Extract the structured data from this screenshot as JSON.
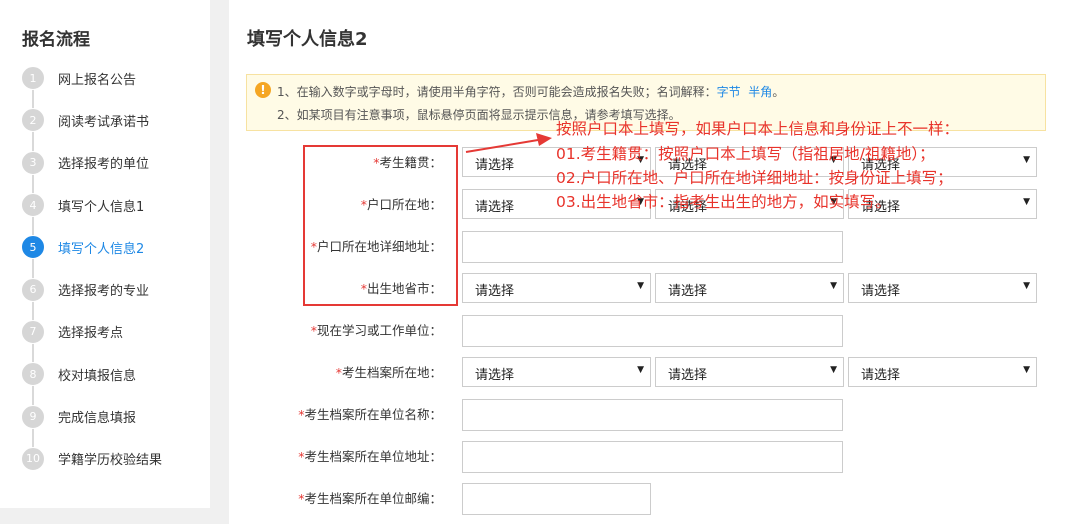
{
  "sidebar": {
    "title": "报名流程",
    "steps": [
      {
        "num": "1",
        "label": "网上报名公告"
      },
      {
        "num": "2",
        "label": "阅读考试承诺书"
      },
      {
        "num": "3",
        "label": "选择报考的单位"
      },
      {
        "num": "4",
        "label": "填写个人信息1"
      },
      {
        "num": "5",
        "label": "填写个人信息2",
        "active": true
      },
      {
        "num": "6",
        "label": "选择报考的专业"
      },
      {
        "num": "7",
        "label": "选择报考点"
      },
      {
        "num": "8",
        "label": "校对填报信息"
      },
      {
        "num": "9",
        "label": "完成信息填报"
      },
      {
        "num": "10",
        "label": "学籍学历校验结果"
      }
    ]
  },
  "main": {
    "title": "填写个人信息2",
    "notice": {
      "line1_prefix": "1、在输入数字或字母时，请使用半角字符，否则可能会造成报名失败；名词解释：",
      "link1": "字节",
      "link2": "半角",
      "line1_suffix": "。",
      "line2": "2、如某项目有注意事项，鼠标悬停页面将显示提示信息，请参考填写选择。"
    },
    "select_placeholder": "请选择",
    "required_mark": "*",
    "fields": {
      "jiguan": "考生籍贯：",
      "hukou": "户口所在地：",
      "hukou_addr": "户口所在地详细地址：",
      "birthplace": "出生地省市：",
      "work_unit": "现在学习或工作单位：",
      "archive_loc": "考生档案所在地：",
      "archive_unit_name": "考生档案所在单位名称：",
      "archive_unit_addr": "考生档案所在单位地址：",
      "archive_unit_zip": "考生档案所在单位邮编："
    }
  },
  "annotation": {
    "line0": "按照户口本上填写，如果户口本上信息和身份证上不一样：",
    "line1": "01.考生籍贯：按照户口本上填写（指祖居地/祖籍地）；",
    "line2": "02.户口所在地、户口所在地详细地址：按身份证上填写；",
    "line3": "03.出生地省市：指考生出生的地方，如实填写。",
    "color": "#e8332b"
  }
}
